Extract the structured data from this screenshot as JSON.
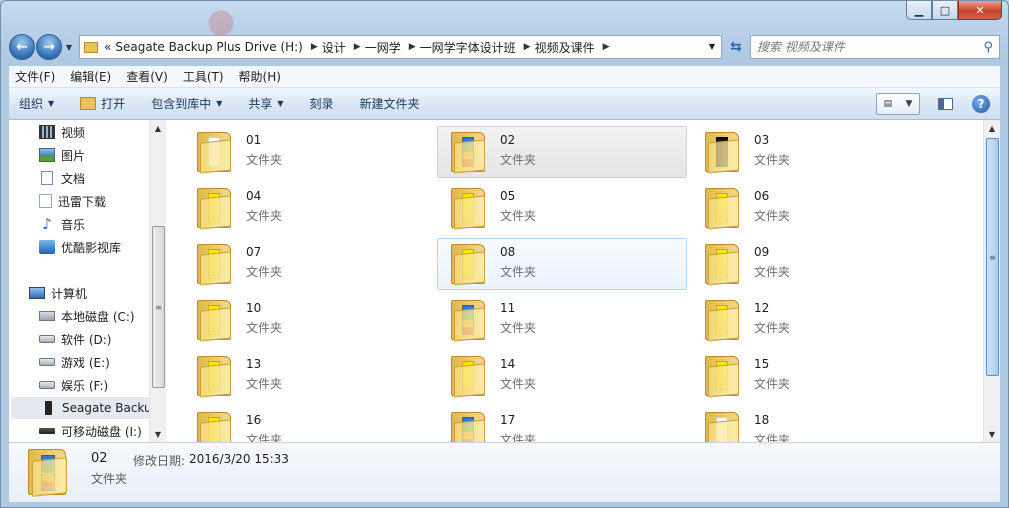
{
  "search": {
    "placeholder": "搜索 视频及课件"
  },
  "address": {
    "overflow": "«",
    "crumbs": [
      "Seagate Backup Plus Drive (H:)",
      "设计",
      "一网学",
      "一网学字体设计班",
      "视频及课件"
    ]
  },
  "menu": [
    "文件(F)",
    "编辑(E)",
    "查看(V)",
    "工具(T)",
    "帮助(H)"
  ],
  "toolbar": {
    "organize": "组织",
    "open": "打开",
    "include_in_library": "包含到库中",
    "share": "共享",
    "burn": "刻录",
    "new_folder": "新建文件夹"
  },
  "nav_pane": {
    "items": [
      {
        "label": "视频",
        "icon": "video-library-icon"
      },
      {
        "label": "图片",
        "icon": "picture-library-icon"
      },
      {
        "label": "文档",
        "icon": "document-library-icon"
      },
      {
        "label": "迅雷下载",
        "icon": "xunlei-download-icon"
      },
      {
        "label": "音乐",
        "icon": "music-library-icon"
      },
      {
        "label": "优酷影视库",
        "icon": "youku-library-icon"
      },
      {
        "label": "计算机",
        "icon": "computer-icon"
      },
      {
        "label": "本地磁盘 (C:)",
        "icon": "system-drive-icon"
      },
      {
        "label": "软件 (D:)",
        "icon": "drive-icon"
      },
      {
        "label": "游戏 (E:)",
        "icon": "drive-icon"
      },
      {
        "label": "娱乐 (F:)",
        "icon": "drive-icon"
      },
      {
        "label": "Seagate Backup Plus Drive (H:)",
        "icon": "external-drive-icon"
      },
      {
        "label": "可移动磁盘 (I:)",
        "icon": "removable-drive-icon"
      }
    ],
    "selected_index": 11
  },
  "folders": [
    {
      "name": "01",
      "type": "文件夹",
      "preview": "white"
    },
    {
      "name": "02",
      "type": "文件夹",
      "preview": "colors"
    },
    {
      "name": "03",
      "type": "文件夹",
      "preview": "dark"
    },
    {
      "name": "04",
      "type": "文件夹",
      "preview": "yellow"
    },
    {
      "name": "05",
      "type": "文件夹",
      "preview": "yellow"
    },
    {
      "name": "06",
      "type": "文件夹",
      "preview": "yellow"
    },
    {
      "name": "07",
      "type": "文件夹",
      "preview": "yellow"
    },
    {
      "name": "08",
      "type": "文件夹",
      "preview": "yellow"
    },
    {
      "name": "09",
      "type": "文件夹",
      "preview": "yellow"
    },
    {
      "name": "10",
      "type": "文件夹",
      "preview": "yellow"
    },
    {
      "name": "11",
      "type": "文件夹",
      "preview": "colors"
    },
    {
      "name": "12",
      "type": "文件夹",
      "preview": "yellow"
    },
    {
      "name": "13",
      "type": "文件夹",
      "preview": "yellow"
    },
    {
      "name": "14",
      "type": "文件夹",
      "preview": "yellow"
    },
    {
      "name": "15",
      "type": "文件夹",
      "preview": "yellow"
    },
    {
      "name": "16",
      "type": "文件夹",
      "preview": "yellow"
    },
    {
      "name": "17",
      "type": "文件夹",
      "preview": "colors"
    },
    {
      "name": "18",
      "type": "文件夹",
      "preview": "white"
    }
  ],
  "selected_folder": "02",
  "hovered_folder": "08",
  "details": {
    "name": "02",
    "type": "文件夹",
    "modified_label": "修改日期:",
    "modified_value": "2016/3/20 15:33"
  },
  "colors": {
    "accent": "#2f6db3",
    "selection": "#e6e6e6",
    "hover": "#eaf3fd"
  }
}
